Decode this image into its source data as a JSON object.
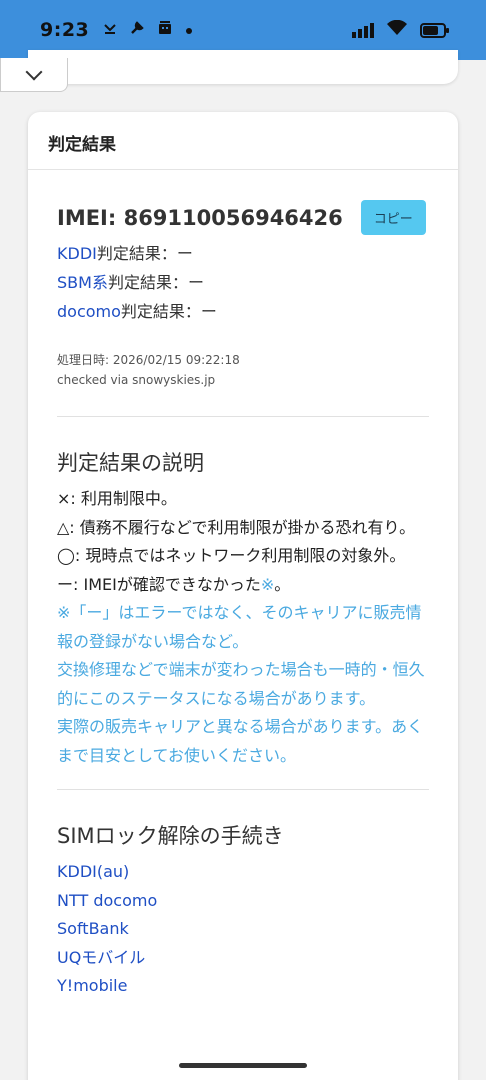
{
  "status_bar": {
    "time": "9:23",
    "left_icons": [
      "download-done-icon",
      "wrench-icon",
      "robot-icon",
      "dot-icon"
    ],
    "right_icons": [
      "signal-icon",
      "wifi-icon",
      "battery-icon"
    ]
  },
  "card": {
    "header": "判定結果",
    "imei_label": "IMEI: 869110056946426",
    "copy_button": "コピー",
    "results": [
      {
        "carrier": "KDDI",
        "suffix": "判定結果：ー"
      },
      {
        "carrier": "SBM系",
        "suffix": "判定結果：ー"
      },
      {
        "carrier": "docomo",
        "suffix": "判定結果：ー"
      }
    ],
    "processed_time": "処理日時: 2026/02/15 09:22:18",
    "checked_via": "checked via snowyskies.jp"
  },
  "explanation": {
    "title": "判定結果の説明",
    "line_x": "×: 利用制限中。",
    "line_triangle": "△: 債務不履行などで利用制限が掛かる恐れ有り。",
    "line_circle": "◯: 現時点ではネットワーク利用制限の対象外。",
    "line_dash_prefix": "ー: IMEIが確認できなかった",
    "line_dash_mark": "※",
    "line_dash_suffix": "。",
    "note1": "※「ー」はエラーではなく、そのキャリアに販売情報の登録がない場合など。",
    "note2": "交換修理などで端末が変わった場合も一時的・恒久的にこのステータスになる場合があります。",
    "note3": "実際の販売キャリアと異なる場合があります。あくまで目安としてお使いください。"
  },
  "simlock": {
    "title": "SIMロック解除の手続き",
    "links": [
      "KDDI(au)",
      "NTT docomo",
      "SoftBank",
      "UQモバイル",
      "Y!mobile"
    ]
  },
  "colors": {
    "status_bar": "#3d8fdc",
    "link": "#1f4fc4",
    "note": "#4aa9e0",
    "copy_button": "#55c8f0"
  }
}
